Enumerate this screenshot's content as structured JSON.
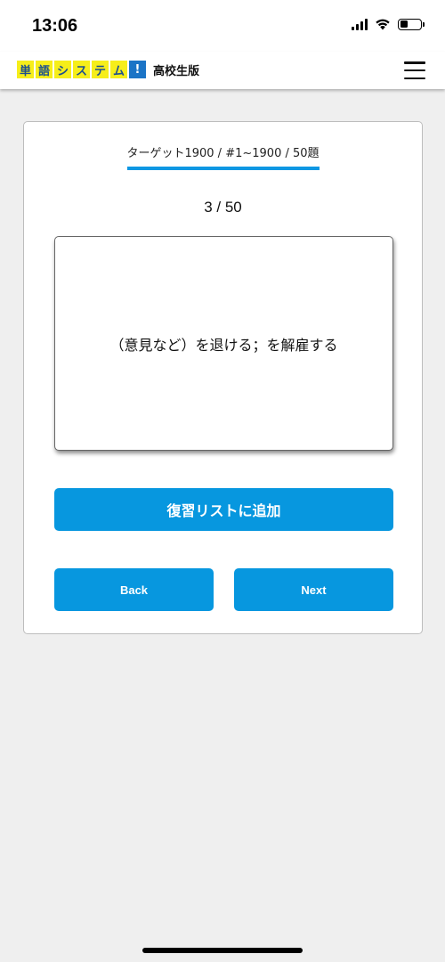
{
  "status_bar": {
    "time": "13:06",
    "icons": [
      "signal-icon",
      "wifi-icon",
      "battery-icon"
    ],
    "battery_level": 0.4
  },
  "header": {
    "logo_chars": [
      "単",
      "語",
      "シ",
      "ス",
      "テ",
      "ム",
      "!"
    ],
    "logo_subtitle": "高校生版",
    "menu_icon": "hamburger-menu-icon"
  },
  "quiz": {
    "deck_title": "ターゲット1900 / #1~1900 / 50題",
    "progress": "3 / 50",
    "card_text": "（意見など）を退ける；を解雇する",
    "review_button": "復習リストに追加",
    "back_button": "Back",
    "next_button": "Next"
  },
  "colors": {
    "accent": "#0797df",
    "logo_yellow": "#f6ee1a",
    "logo_blue": "#1b74c6",
    "background": "#efefef"
  }
}
